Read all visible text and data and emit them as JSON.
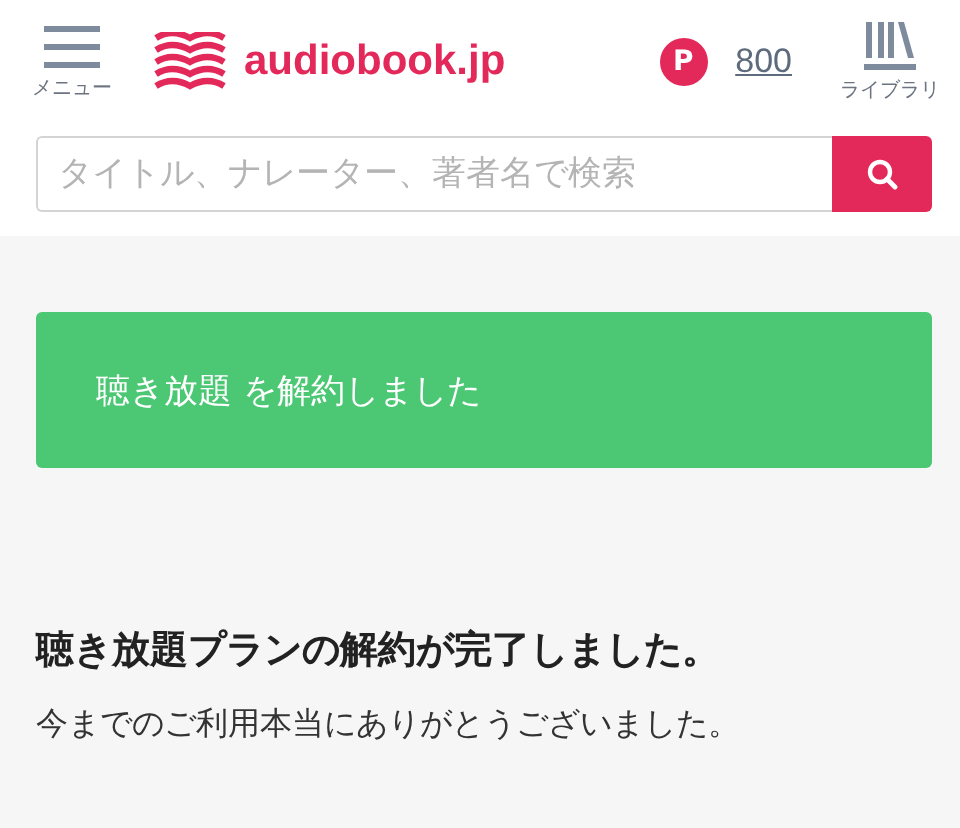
{
  "header": {
    "menu_label": "メニュー",
    "logo_text": "audiobook.jp",
    "points_badge": "P",
    "points": "800",
    "library_label": "ライブラリ"
  },
  "search": {
    "placeholder": "タイトル、ナレーター、著者名で検索"
  },
  "banner": {
    "message": "聴き放題 を解約しました"
  },
  "content": {
    "heading": "聴き放題プランの解約が完了しました。",
    "body": "今までのご利用本当にありがとうございました。"
  }
}
